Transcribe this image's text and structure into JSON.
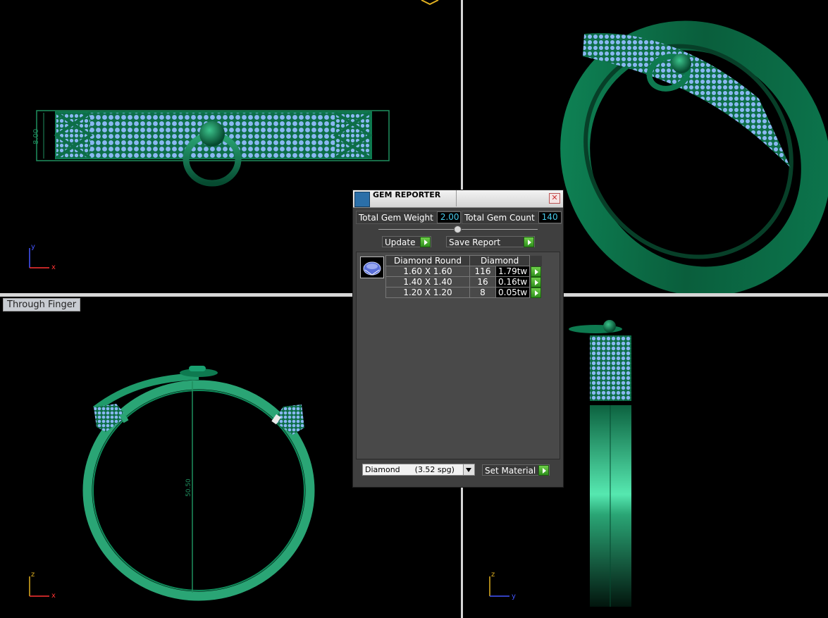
{
  "viewports": {
    "bottom_left_label": "Through Finger",
    "top_left_dimension": "8.00",
    "bottom_left_dimension": "50.50",
    "axis_x": "x",
    "axis_y": "y",
    "axis_z": "z"
  },
  "gem_reporter": {
    "title": "GEM REPORTER",
    "close_symbol": "✕",
    "total_gem_weight_label": "Total Gem Weight",
    "total_gem_weight_value": "2.00",
    "total_gem_count_label": "Total Gem Count",
    "total_gem_count_value": "140",
    "update_label": "Update",
    "save_report_label": "Save Report",
    "table": {
      "header_shape": "Diamond Round",
      "header_material": "Diamond",
      "rows": [
        {
          "size": "1.60 X 1.60",
          "count": "116",
          "weight": "1.79tw"
        },
        {
          "size": "1.40 X 1.40",
          "count": "16",
          "weight": "0.16tw"
        },
        {
          "size": "1.20 X 1.20",
          "count": "8",
          "weight": "0.05tw"
        }
      ]
    },
    "material_select_value": "Diamond      (3.52 spg)",
    "set_material_label": "Set Material"
  },
  "colors": {
    "metal": "#0d7a4f",
    "metal_light": "#2aa575",
    "gem": "#7fb0f0",
    "value_text": "#46c8e8"
  }
}
